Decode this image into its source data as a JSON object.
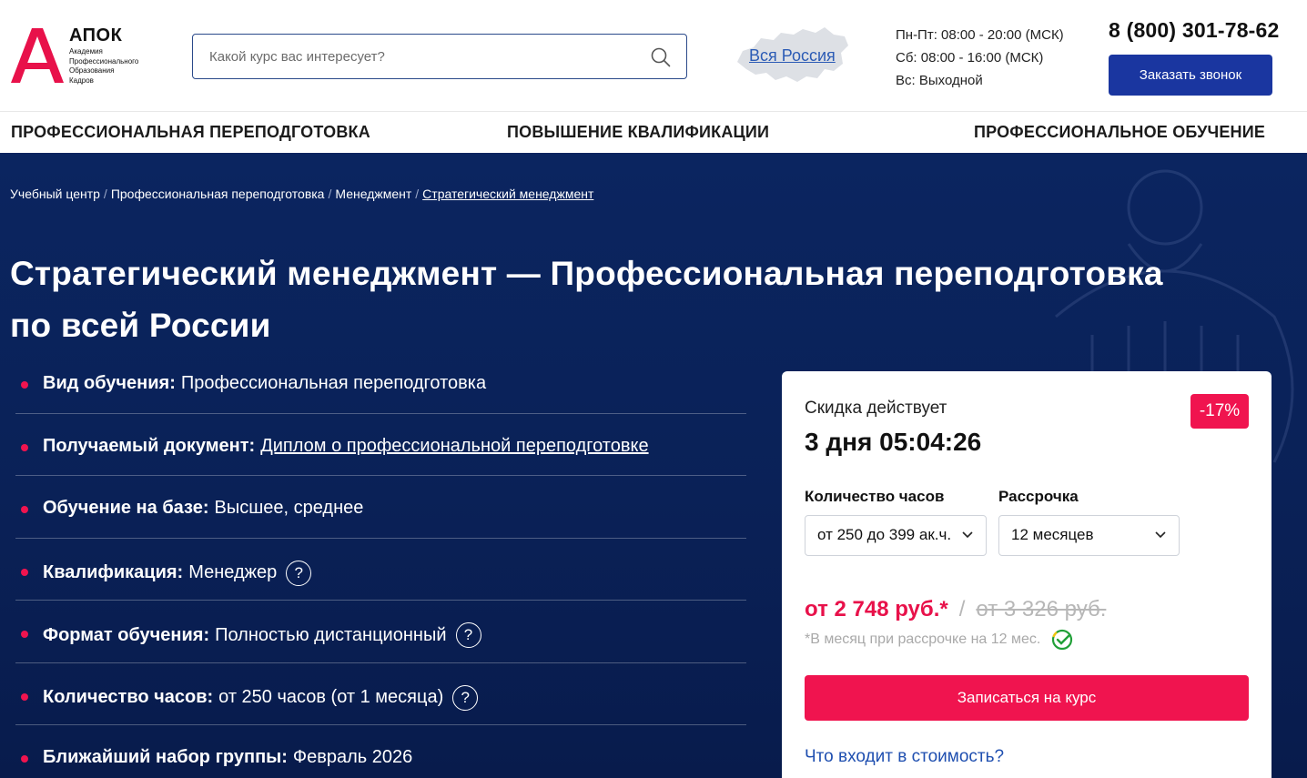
{
  "header": {
    "logo": {
      "title": "АПОК",
      "letter": "А",
      "subtitle": [
        "Академия",
        "Профессионального",
        "Образования",
        "Кадров"
      ]
    },
    "search": {
      "placeholder": "Какой курс вас интересует?",
      "value": ""
    },
    "region": {
      "label": "Вся Россия"
    },
    "hours": [
      "Пн-Пт: 08:00 - 20:00 (МСК)",
      "Сб: 08:00 - 16:00 (МСК)",
      "Вс: Выходной"
    ],
    "phone": "8 (800) 301-78-62",
    "callback_button": "Заказать звонок"
  },
  "nav": {
    "items": [
      "ПРОФЕССИОНАЛЬНАЯ ПЕРЕПОДГОТОВКА",
      "ПОВЫШЕНИЕ КВАЛИФИКАЦИИ",
      "ПРОФЕССИОНАЛЬНОЕ ОБУЧЕНИЕ"
    ]
  },
  "breadcrumb": [
    "Учебный центр",
    "Профессиональная переподготовка",
    "Менеджмент",
    "Стратегический менеджмент"
  ],
  "page_title_line1": "Стратегический менеджмент — Профессиональная переподготовка",
  "page_title_line2": "по всей России",
  "properties": [
    {
      "label": "Вид обучения:",
      "value": "Профессиональная переподготовка"
    },
    {
      "label": "Получаемый документ:",
      "value": "Диплом о профессиональной переподготовке"
    },
    {
      "label": "Обучение на базе:",
      "value": "Высшее, среднее"
    },
    {
      "label": "Квалификация:",
      "value": "Менеджер"
    },
    {
      "label": "Формат обучения:",
      "value": "Полностью дистанционный"
    },
    {
      "label": "Количество часов:",
      "value": "от 250 часов (от 1 месяца)"
    },
    {
      "label": "Ближайший набор группы:",
      "value": "Февраль 2026"
    }
  ],
  "card": {
    "discount_label": "Скидка действует",
    "timer": "3 дня 05:04:26",
    "badge": "-17%",
    "hours_label": "Количество часов",
    "hours_value": "от 250 до 399 ак.ч.",
    "installment_label": "Рассрочка",
    "installment_value": "12 месяцев",
    "price_new": "от 2 748 руб.*",
    "price_separator": "/",
    "price_old": "от 3 326 руб.",
    "price_note": "*В месяц при рассрочке на 12 мес.",
    "enroll_button": "Записаться на курс",
    "included_link": "Что входит в стоимость?"
  },
  "colors": {
    "accent": "#f0144f",
    "brand_blue": "#1a36a0",
    "hero_bg": "#0b2560",
    "link_blue": "#2b5bb5"
  },
  "icons": [
    "search-icon",
    "russia-map-icon",
    "question-icon",
    "chevron-down-icon",
    "sber-check-icon"
  ]
}
